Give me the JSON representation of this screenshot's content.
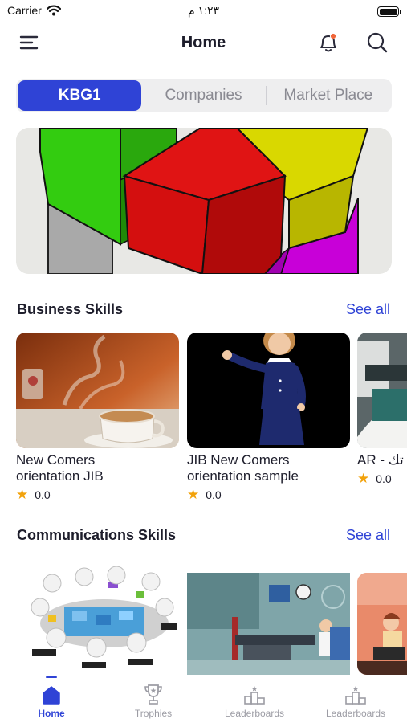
{
  "status_bar": {
    "carrier": "Carrier",
    "time": "١:٢٣ م"
  },
  "header": {
    "title": "Home"
  },
  "segments": [
    {
      "label": "KBG1",
      "active": true
    },
    {
      "label": "Companies",
      "active": false
    },
    {
      "label": "Market Place",
      "active": false
    }
  ],
  "sections": [
    {
      "title": "Business Skills",
      "see_all": "See all",
      "cards": [
        {
          "title": "New Comers\norientation JIB",
          "rating": "0.0"
        },
        {
          "title": "JIB New Comers\norientation  sample",
          "rating": "0.0"
        },
        {
          "title": "AR - تك",
          "rating": "0.0"
        }
      ]
    },
    {
      "title": "Communications Skills",
      "see_all": "See all",
      "cards": [
        {},
        {},
        {}
      ]
    }
  ],
  "tabbar": [
    {
      "label": "Home",
      "icon": "home-icon",
      "active": true
    },
    {
      "label": "Trophies",
      "icon": "trophy-icon",
      "active": false
    },
    {
      "label": "Leaderboards",
      "icon": "podium-icon",
      "active": false
    },
    {
      "label": "Leaderboards",
      "icon": "podium-icon",
      "active": false
    }
  ],
  "colors": {
    "accent": "#2f43d6",
    "star": "#f2a20b",
    "notification_dot": "#f0663a"
  }
}
